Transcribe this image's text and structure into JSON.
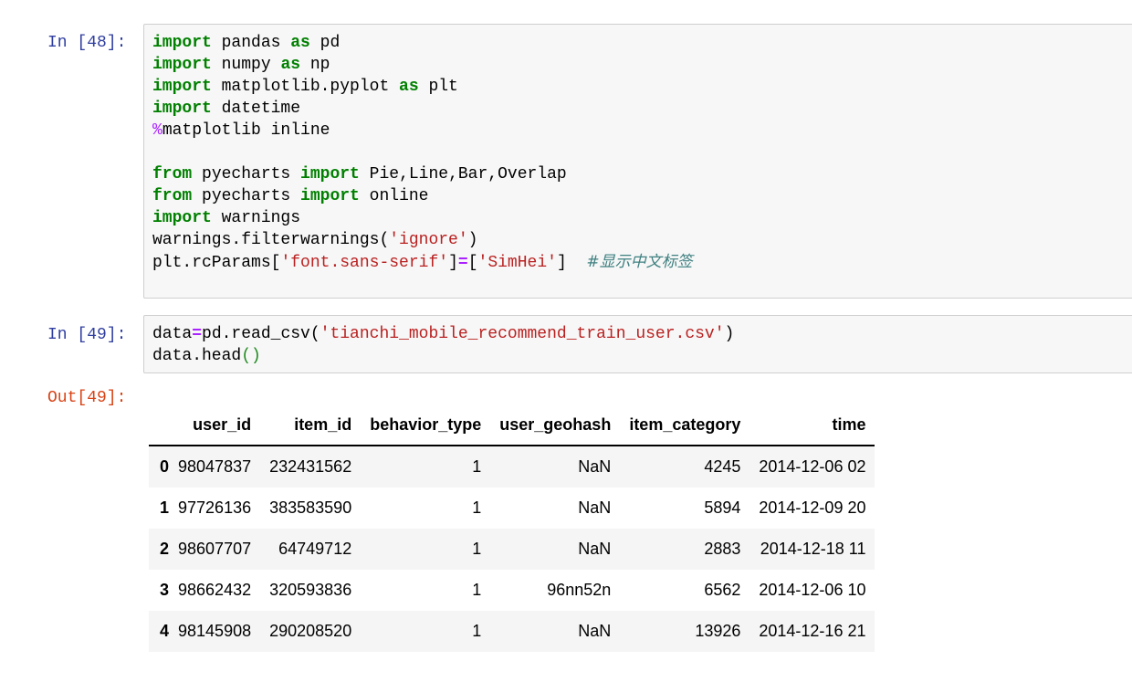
{
  "cells": [
    {
      "prompt": "In [48]:",
      "lines": [
        "import pandas as pd",
        "import numpy as np",
        "import matplotlib.pyplot as plt",
        "import datetime",
        "%matplotlib inline",
        "",
        "from pyecharts import Pie,Line,Bar,Overlap",
        "from pyecharts import online",
        "import warnings",
        "warnings.filterwarnings('ignore')",
        "plt.rcParams['font.sans-serif']=['SimHei']  #显示中文标签"
      ]
    },
    {
      "prompt": "In [49]:",
      "lines": [
        "data=pd.read_csv('tianchi_mobile_recommend_train_user.csv')",
        "data.head()"
      ]
    }
  ],
  "output": {
    "prompt": "Out[49]:",
    "columns": [
      "",
      "user_id",
      "item_id",
      "behavior_type",
      "user_geohash",
      "item_category",
      "time"
    ],
    "rows": [
      [
        "0",
        "98047837",
        "232431562",
        "1",
        "NaN",
        "4245",
        "2014-12-06 02"
      ],
      [
        "1",
        "97726136",
        "383583590",
        "1",
        "NaN",
        "5894",
        "2014-12-09 20"
      ],
      [
        "2",
        "98607707",
        "64749712",
        "1",
        "NaN",
        "2883",
        "2014-12-18 11"
      ],
      [
        "3",
        "98662432",
        "320593836",
        "1",
        "96nn52n",
        "6562",
        "2014-12-06 10"
      ],
      [
        "4",
        "98145908",
        "290208520",
        "1",
        "NaN",
        "13926",
        "2014-12-16 21"
      ]
    ]
  }
}
